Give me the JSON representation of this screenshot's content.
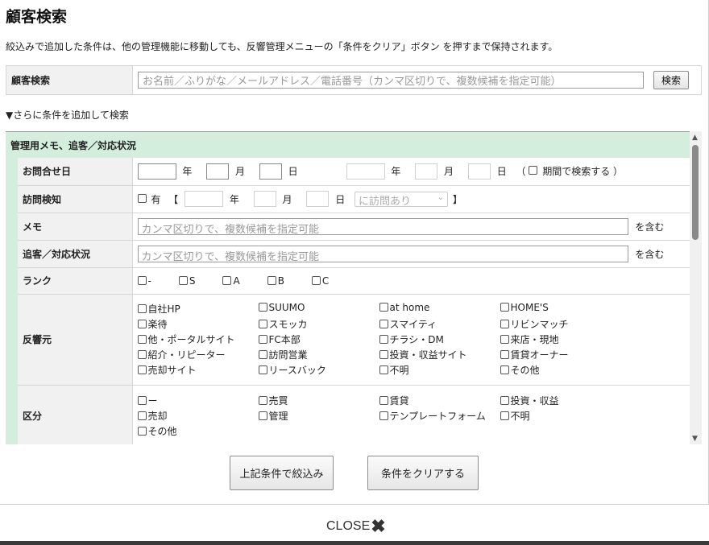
{
  "modal": {
    "title": "顧客検索",
    "notice": "絞込みで追加した条件は、他の管理機能に移動しても、反響管理メニューの「条件をクリア」ボタン を押すまで保持されます。"
  },
  "search": {
    "label": "顧客検索",
    "placeholder": "お名前／ふりがな／メールアドレス／電話番号（カンマ区切りで、複数候補を指定可能）",
    "button": "検索"
  },
  "more_toggle": "▼さらに条件を追加して検索",
  "panel": {
    "heading": "管理用メモ、追客／対応状況",
    "rows": {
      "inquiry_date": {
        "label": "お問合せ日",
        "year": "年",
        "month": "月",
        "day": "日",
        "period_open": "（",
        "period_label": "期間で検索する",
        "period_close": "）"
      },
      "visit": {
        "label": "訪問検知",
        "has": "有",
        "bracket_open": "【",
        "bracket_close": "】",
        "year": "年",
        "month": "月",
        "day": "日",
        "select_value": "に訪問あり"
      },
      "memo": {
        "label": "メモ",
        "placeholder": "カンマ区切りで、複数候補を指定可能",
        "suffix": "を含む"
      },
      "followup": {
        "label": "追客／対応状況",
        "placeholder": "カンマ区切りで、複数候補を指定可能",
        "suffix": "を含む"
      },
      "rank": {
        "label": "ランク",
        "options": [
          "-",
          "S",
          "A",
          "B",
          "C"
        ]
      },
      "source": {
        "label": "反響元",
        "options": [
          "自社HP",
          "SUUMO",
          "at home",
          "HOME'S",
          "楽待",
          "スモッカ",
          "スマイティ",
          "リビンマッチ",
          "他・ポータルサイト",
          "FC本部",
          "チラシ・DM",
          "来店・現地",
          "紹介・リピーター",
          "訪問営業",
          "投資・収益サイト",
          "賃貸オーナー",
          "売却サイト",
          "リースバック",
          "不明",
          "その他"
        ]
      },
      "category": {
        "label": "区分",
        "options": [
          "ー",
          "売買",
          "賃貸",
          "投資・収益",
          "売却",
          "管理",
          "テンプレートフォーム",
          "不明",
          "その他"
        ]
      }
    }
  },
  "actions": {
    "filter": "上記条件で絞込み",
    "clear": "条件をクリアする"
  },
  "close_label": "CLOSE",
  "colors": {
    "panel_bg": "#d4eedd",
    "panel_border": "#6cb98a",
    "label_bg": "#f1f1f1"
  }
}
